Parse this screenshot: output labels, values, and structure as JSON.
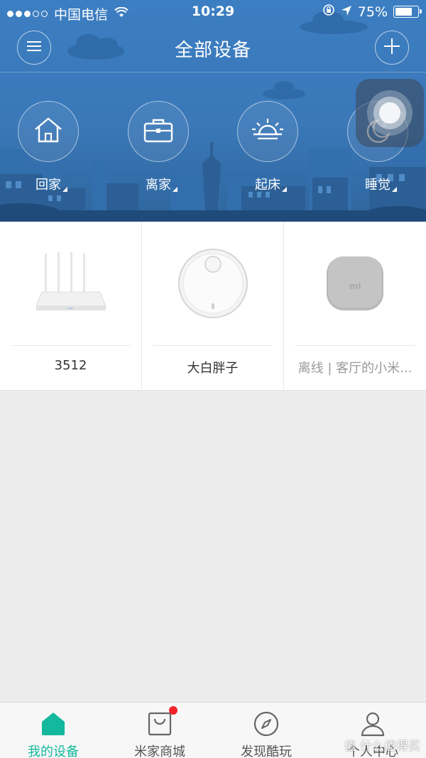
{
  "status_bar": {
    "carrier": "中国电信",
    "time": "10:29",
    "battery": "75%",
    "battery_level": 0.75
  },
  "header": {
    "title": "全部设备",
    "menu_icon": "menu-icon",
    "add_icon": "plus-icon"
  },
  "scenes": [
    {
      "label": "回家",
      "icon": "home-icon"
    },
    {
      "label": "离家",
      "icon": "briefcase-icon"
    },
    {
      "label": "起床",
      "icon": "sunrise-icon"
    },
    {
      "label": "睡觉",
      "icon": "moon-icon"
    }
  ],
  "devices": [
    {
      "name": "3512",
      "image": "router",
      "offline": false
    },
    {
      "name": "大白胖子",
      "image": "robot-vacuum",
      "offline": false
    },
    {
      "name": "离线 | 客厅的小米...",
      "image": "mi-device",
      "offline": true
    }
  ],
  "tabbar": {
    "tabs": [
      {
        "label": "我的设备",
        "icon": "home-icon",
        "active": true
      },
      {
        "label": "米家商城",
        "icon": "shopping-bag-icon",
        "active": false,
        "badge": true
      },
      {
        "label": "发现酷玩",
        "icon": "compass-icon",
        "active": false
      },
      {
        "label": "个人中心",
        "icon": "user-icon",
        "active": false
      }
    ]
  },
  "colors": {
    "header_blue": "#3a78b8",
    "accent_green": "#14b89c",
    "badge_red": "#f5232b"
  },
  "watermark": "值 什么值得买"
}
